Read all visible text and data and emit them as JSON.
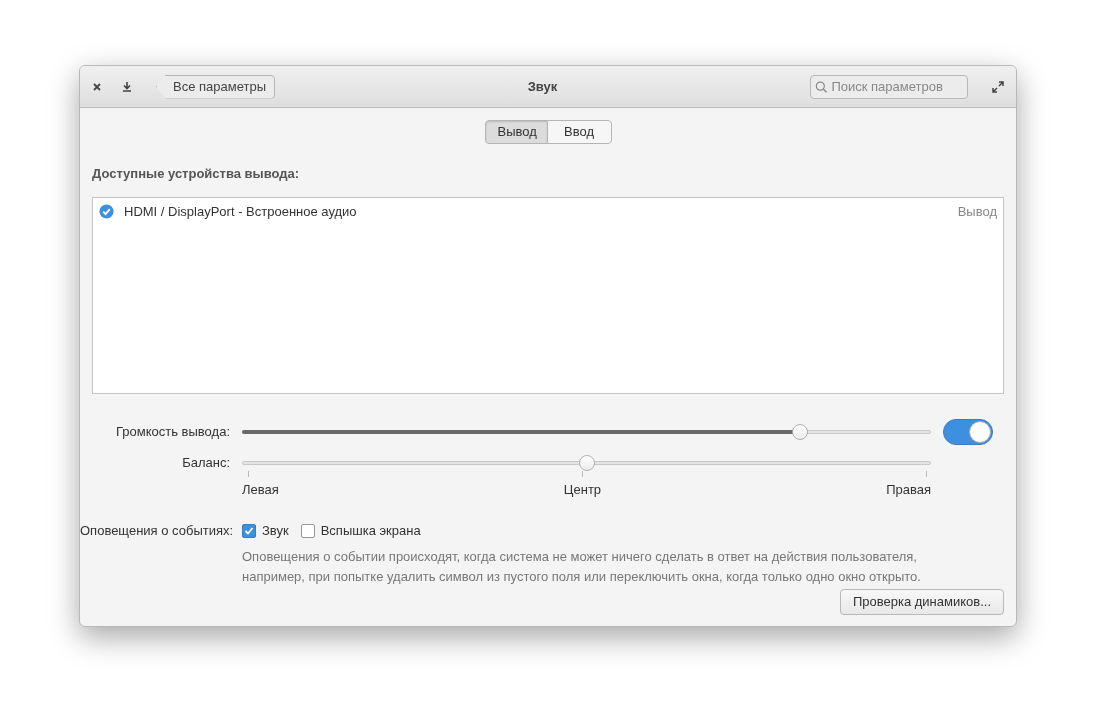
{
  "window": {
    "title": "Звук",
    "back_button": "Все параметры",
    "search": {
      "placeholder": "Поиск параметров"
    }
  },
  "tabs": [
    {
      "label": "Вывод",
      "selected": true
    },
    {
      "label": "Ввод",
      "selected": false
    }
  ],
  "devices": {
    "heading": "Доступные устройства вывода:",
    "items": [
      {
        "name": "HDMI / DisplayPort - Встроенное аудио",
        "type": "Вывод",
        "selected": true
      }
    ]
  },
  "volume": {
    "label": "Громкость вывода:",
    "level": 0.81,
    "on": true
  },
  "balance": {
    "label": "Баланс:",
    "level": 0.5,
    "marks": [
      "Левая",
      "Центр",
      "Правая"
    ]
  },
  "alerts": {
    "label": "Оповещения о событиях:",
    "options": [
      {
        "label": "Звук",
        "checked": true
      },
      {
        "label": "Вспышка экрана",
        "checked": false
      }
    ],
    "description": "Оповещения о событии происходят, когда система не может ничего сделать в ответ на действия пользователя, например, при попытке удалить символ из пустого поля или переключить окна, когда только одно окно открыто."
  },
  "test_button": "Проверка динамиков..."
}
